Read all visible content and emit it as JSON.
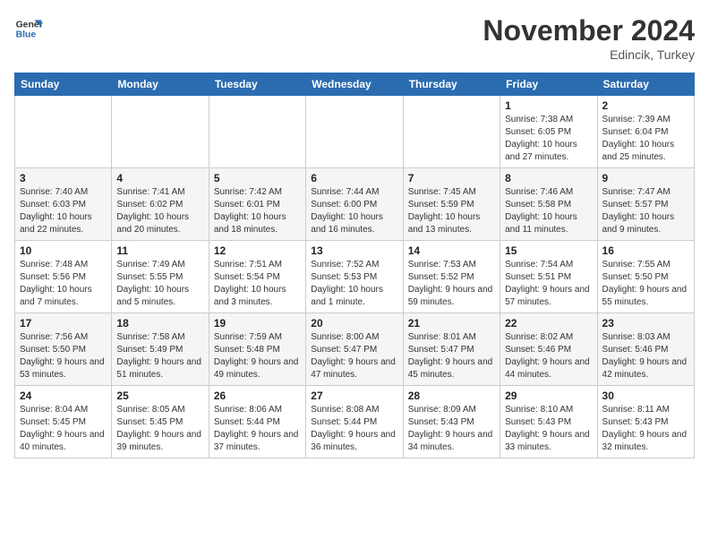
{
  "header": {
    "logo_line1": "General",
    "logo_line2": "Blue",
    "month": "November 2024",
    "location": "Edincik, Turkey"
  },
  "weekdays": [
    "Sunday",
    "Monday",
    "Tuesday",
    "Wednesday",
    "Thursday",
    "Friday",
    "Saturday"
  ],
  "weeks": [
    [
      {
        "day": "",
        "info": ""
      },
      {
        "day": "",
        "info": ""
      },
      {
        "day": "",
        "info": ""
      },
      {
        "day": "",
        "info": ""
      },
      {
        "day": "",
        "info": ""
      },
      {
        "day": "1",
        "info": "Sunrise: 7:38 AM\nSunset: 6:05 PM\nDaylight: 10 hours and 27 minutes."
      },
      {
        "day": "2",
        "info": "Sunrise: 7:39 AM\nSunset: 6:04 PM\nDaylight: 10 hours and 25 minutes."
      }
    ],
    [
      {
        "day": "3",
        "info": "Sunrise: 7:40 AM\nSunset: 6:03 PM\nDaylight: 10 hours and 22 minutes."
      },
      {
        "day": "4",
        "info": "Sunrise: 7:41 AM\nSunset: 6:02 PM\nDaylight: 10 hours and 20 minutes."
      },
      {
        "day": "5",
        "info": "Sunrise: 7:42 AM\nSunset: 6:01 PM\nDaylight: 10 hours and 18 minutes."
      },
      {
        "day": "6",
        "info": "Sunrise: 7:44 AM\nSunset: 6:00 PM\nDaylight: 10 hours and 16 minutes."
      },
      {
        "day": "7",
        "info": "Sunrise: 7:45 AM\nSunset: 5:59 PM\nDaylight: 10 hours and 13 minutes."
      },
      {
        "day": "8",
        "info": "Sunrise: 7:46 AM\nSunset: 5:58 PM\nDaylight: 10 hours and 11 minutes."
      },
      {
        "day": "9",
        "info": "Sunrise: 7:47 AM\nSunset: 5:57 PM\nDaylight: 10 hours and 9 minutes."
      }
    ],
    [
      {
        "day": "10",
        "info": "Sunrise: 7:48 AM\nSunset: 5:56 PM\nDaylight: 10 hours and 7 minutes."
      },
      {
        "day": "11",
        "info": "Sunrise: 7:49 AM\nSunset: 5:55 PM\nDaylight: 10 hours and 5 minutes."
      },
      {
        "day": "12",
        "info": "Sunrise: 7:51 AM\nSunset: 5:54 PM\nDaylight: 10 hours and 3 minutes."
      },
      {
        "day": "13",
        "info": "Sunrise: 7:52 AM\nSunset: 5:53 PM\nDaylight: 10 hours and 1 minute."
      },
      {
        "day": "14",
        "info": "Sunrise: 7:53 AM\nSunset: 5:52 PM\nDaylight: 9 hours and 59 minutes."
      },
      {
        "day": "15",
        "info": "Sunrise: 7:54 AM\nSunset: 5:51 PM\nDaylight: 9 hours and 57 minutes."
      },
      {
        "day": "16",
        "info": "Sunrise: 7:55 AM\nSunset: 5:50 PM\nDaylight: 9 hours and 55 minutes."
      }
    ],
    [
      {
        "day": "17",
        "info": "Sunrise: 7:56 AM\nSunset: 5:50 PM\nDaylight: 9 hours and 53 minutes."
      },
      {
        "day": "18",
        "info": "Sunrise: 7:58 AM\nSunset: 5:49 PM\nDaylight: 9 hours and 51 minutes."
      },
      {
        "day": "19",
        "info": "Sunrise: 7:59 AM\nSunset: 5:48 PM\nDaylight: 9 hours and 49 minutes."
      },
      {
        "day": "20",
        "info": "Sunrise: 8:00 AM\nSunset: 5:47 PM\nDaylight: 9 hours and 47 minutes."
      },
      {
        "day": "21",
        "info": "Sunrise: 8:01 AM\nSunset: 5:47 PM\nDaylight: 9 hours and 45 minutes."
      },
      {
        "day": "22",
        "info": "Sunrise: 8:02 AM\nSunset: 5:46 PM\nDaylight: 9 hours and 44 minutes."
      },
      {
        "day": "23",
        "info": "Sunrise: 8:03 AM\nSunset: 5:46 PM\nDaylight: 9 hours and 42 minutes."
      }
    ],
    [
      {
        "day": "24",
        "info": "Sunrise: 8:04 AM\nSunset: 5:45 PM\nDaylight: 9 hours and 40 minutes."
      },
      {
        "day": "25",
        "info": "Sunrise: 8:05 AM\nSunset: 5:45 PM\nDaylight: 9 hours and 39 minutes."
      },
      {
        "day": "26",
        "info": "Sunrise: 8:06 AM\nSunset: 5:44 PM\nDaylight: 9 hours and 37 minutes."
      },
      {
        "day": "27",
        "info": "Sunrise: 8:08 AM\nSunset: 5:44 PM\nDaylight: 9 hours and 36 minutes."
      },
      {
        "day": "28",
        "info": "Sunrise: 8:09 AM\nSunset: 5:43 PM\nDaylight: 9 hours and 34 minutes."
      },
      {
        "day": "29",
        "info": "Sunrise: 8:10 AM\nSunset: 5:43 PM\nDaylight: 9 hours and 33 minutes."
      },
      {
        "day": "30",
        "info": "Sunrise: 8:11 AM\nSunset: 5:43 PM\nDaylight: 9 hours and 32 minutes."
      }
    ]
  ]
}
